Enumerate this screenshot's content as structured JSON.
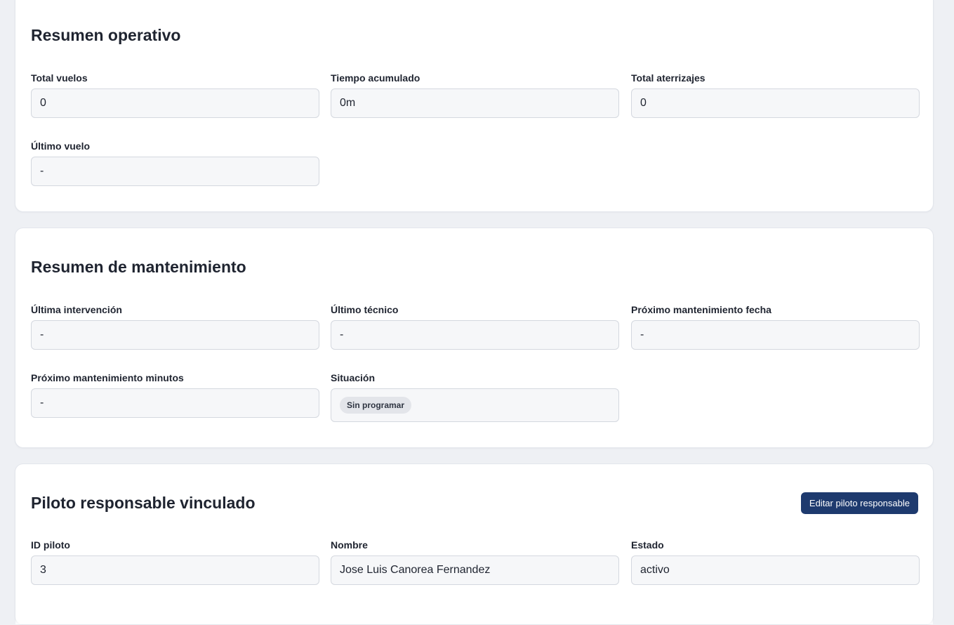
{
  "operational_summary": {
    "title": "Resumen operativo",
    "fields": {
      "total_flights": {
        "label": "Total vuelos",
        "value": "0"
      },
      "accumulated_time": {
        "label": "Tiempo acumulado",
        "value": "0m"
      },
      "total_landings": {
        "label": "Total aterrizajes",
        "value": "0"
      },
      "last_flight": {
        "label": "Último vuelo",
        "value": "-"
      }
    }
  },
  "maintenance_summary": {
    "title": "Resumen de mantenimiento",
    "fields": {
      "last_intervention": {
        "label": "Última intervención",
        "value": "-"
      },
      "last_technician": {
        "label": "Último técnico",
        "value": "-"
      },
      "next_maintenance_date": {
        "label": "Próximo mantenimiento fecha",
        "value": "-"
      },
      "next_maintenance_minutes": {
        "label": "Próximo mantenimiento minutos",
        "value": "-"
      },
      "situation": {
        "label": "Situación",
        "badge": "Sin programar"
      }
    }
  },
  "responsible_pilot": {
    "title": "Piloto responsable vinculado",
    "edit_button": "Editar piloto responsable",
    "fields": {
      "pilot_id": {
        "label": "ID piloto",
        "value": "3"
      },
      "name": {
        "label": "Nombre",
        "value": "Jose Luis Canorea Fernandez"
      },
      "status": {
        "label": "Estado",
        "value": "activo"
      }
    }
  },
  "colors": {
    "page_background": "#eef0f4",
    "card_background": "#ffffff",
    "field_background": "#f6f7f9",
    "primary_button": "#1e3a6e",
    "badge_background": "#e3e5ea"
  }
}
